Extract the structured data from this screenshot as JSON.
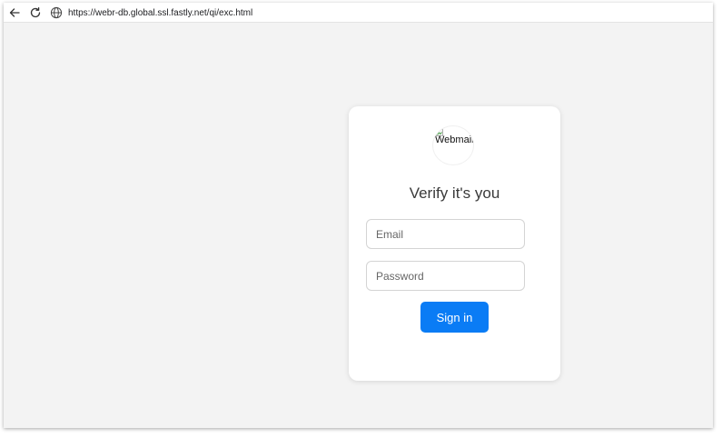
{
  "browser": {
    "url": "https://webr-db.global.ssl.fastly.net/qi/exc.html"
  },
  "login": {
    "logo_alt": "Webmail",
    "title": "Verify it's you",
    "email_placeholder": "Email",
    "password_placeholder": "Password",
    "sign_in_label": "Sign in"
  },
  "colors": {
    "accent": "#0a7cf5",
    "page_background": "#f3f3f3",
    "card_background": "#ffffff"
  }
}
